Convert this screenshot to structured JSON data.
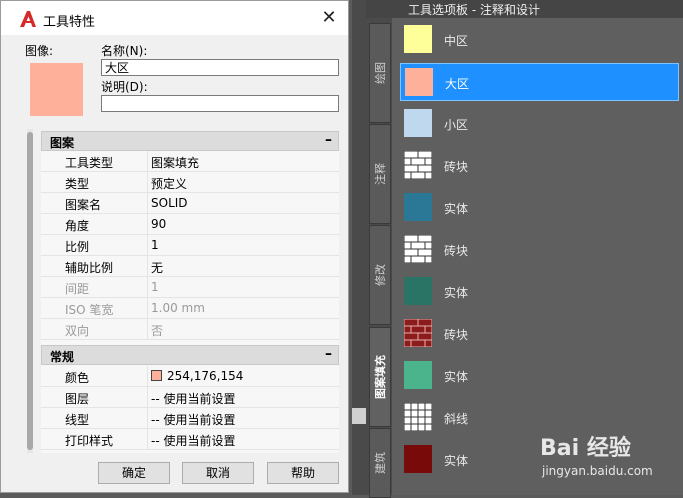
{
  "dialog": {
    "title": "工具特性",
    "image_label": "图像:",
    "name_label": "名称(N):",
    "name_value": "大区",
    "desc_label": "说明(D):",
    "desc_value": "",
    "swatch_color": "#feb09a",
    "sections": [
      {
        "title": "图案",
        "toggle": "–",
        "rows": [
          {
            "key": "工具类型",
            "value": "图案填充",
            "disabled": false
          },
          {
            "key": "类型",
            "value": "预定义",
            "disabled": false
          },
          {
            "key": "图案名",
            "value": "SOLID",
            "disabled": false
          },
          {
            "key": "角度",
            "value": "90",
            "disabled": false
          },
          {
            "key": "比例",
            "value": "1",
            "disabled": false
          },
          {
            "key": "辅助比例",
            "value": "无",
            "disabled": false
          },
          {
            "key": "间距",
            "value": "1",
            "disabled": true
          },
          {
            "key": "ISO 笔宽",
            "value": "1.00 mm",
            "disabled": true
          },
          {
            "key": "双向",
            "value": "否",
            "disabled": true
          }
        ]
      },
      {
        "title": "常规",
        "toggle": "–",
        "rows": [
          {
            "key": "颜色",
            "value": "254,176,154",
            "disabled": false
          },
          {
            "key": "图层",
            "value": "-- 使用当前设置",
            "disabled": false
          },
          {
            "key": "线型",
            "value": "-- 使用当前设置",
            "disabled": false
          },
          {
            "key": "打印样式",
            "value": "-- 使用当前设置",
            "disabled": false
          }
        ]
      }
    ],
    "buttons": {
      "ok": "确定",
      "cancel": "取消",
      "help": "帮助"
    }
  },
  "palette": {
    "title": "工具选项板 - 注释和设计",
    "tabs": [
      {
        "label": "绘图",
        "active": false
      },
      {
        "label": "注释",
        "active": false
      },
      {
        "label": "修改",
        "active": false
      },
      {
        "label": "图案填充",
        "active": true
      },
      {
        "label": "建筑",
        "active": false
      }
    ],
    "items": [
      {
        "label": "中区",
        "icon": "solid-swatch-icon",
        "color": "#ffff99",
        "selected": false
      },
      {
        "label": "大区",
        "icon": "solid-swatch-icon",
        "color": "#feb09a",
        "selected": true
      },
      {
        "label": "小区",
        "icon": "solid-swatch-icon",
        "color": "#bfd8ee",
        "selected": false
      },
      {
        "label": "砖块",
        "icon": "brick-pattern-icon",
        "color": "#ffffff",
        "selected": false
      },
      {
        "label": "实体",
        "icon": "solid-swatch-icon",
        "color": "#2a7896",
        "selected": false
      },
      {
        "label": "砖块",
        "icon": "brick-pattern-icon",
        "color": "#ffffff",
        "selected": false
      },
      {
        "label": "实体",
        "icon": "solid-swatch-icon",
        "color": "#2a7466",
        "selected": false
      },
      {
        "label": "砖块",
        "icon": "brick-pattern-icon",
        "color": "#8c1c1c",
        "selected": false
      },
      {
        "label": "实体",
        "icon": "solid-swatch-icon",
        "color": "#4bb48c",
        "selected": false
      },
      {
        "label": "斜线",
        "icon": "grid-pattern-icon",
        "color": "#ffffff",
        "selected": false
      },
      {
        "label": "实体",
        "icon": "solid-swatch-icon",
        "color": "#780a0a",
        "selected": false
      }
    ]
  },
  "watermark": {
    "logo": "Bai 经验",
    "url": "jingyan.baidu.com"
  }
}
